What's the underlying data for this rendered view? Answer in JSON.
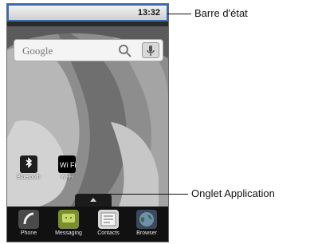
{
  "status_bar": {
    "time": "13:32"
  },
  "search_widget": {
    "brand": "Google"
  },
  "shortcuts": [
    {
      "label": "Bluetooth",
      "icon": "bluetooth-icon"
    },
    {
      "label": "Wi-Fi",
      "icon": "wifi-icon",
      "badge": "Wi Fi"
    }
  ],
  "dock": [
    {
      "label": "Phone",
      "icon": "phone-icon",
      "color": "#4a4a4a"
    },
    {
      "label": "Messaging",
      "icon": "messaging-icon",
      "color": "#7a8f2b"
    },
    {
      "label": "Contacts",
      "icon": "contacts-icon",
      "color": "#d9d9d9"
    },
    {
      "label": "Browser",
      "icon": "browser-icon",
      "color": "#3a4a5a"
    }
  ],
  "callouts": {
    "status_bar": "Barre d'état",
    "app_tab": "Onglet Application"
  },
  "colors": {
    "status_highlight": "#2f6fbf"
  }
}
